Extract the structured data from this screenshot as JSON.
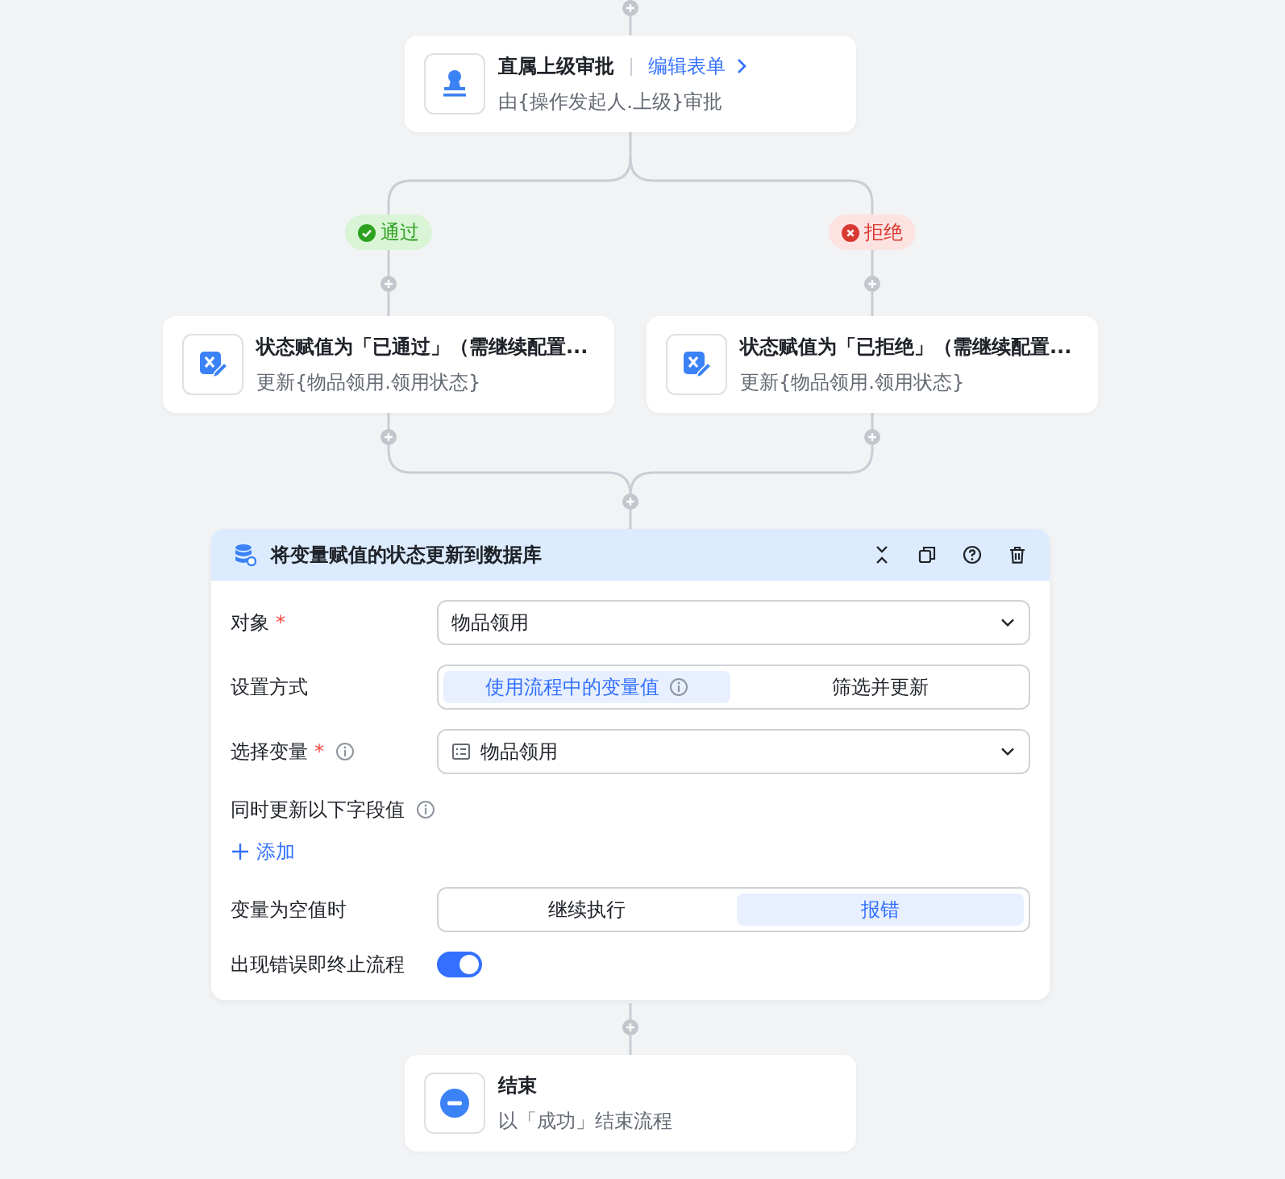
{
  "approval_node": {
    "title": "直属上级审批",
    "link": "编辑表单",
    "subtitle": "由{操作发起人.上级}审批"
  },
  "branches": [
    {
      "kind": "approve",
      "label": "通过",
      "node": {
        "title": "状态赋值为「已通过」（需继续配置...",
        "subtitle": "更新{物品领用.领用状态}"
      }
    },
    {
      "kind": "reject",
      "label": "拒绝",
      "node": {
        "title": "状态赋值为「已拒绝」（需继续配置...",
        "subtitle": "更新{物品领用.领用状态}"
      }
    }
  ],
  "update_node": {
    "title": "将变量赋值的状态更新到数据库",
    "fields": [
      {
        "kind": "select",
        "label": "对象",
        "required_mark": "*",
        "value": "物品领用"
      },
      {
        "kind": "segmented",
        "label": "设置方式",
        "options": [
          {
            "label": "使用流程中的变量值",
            "selected": true,
            "info": true
          },
          {
            "label": "筛选并更新",
            "selected": false
          }
        ]
      },
      {
        "kind": "select",
        "label": "选择变量",
        "required_mark": "*",
        "info": true,
        "value": "物品领用",
        "value_icon": true
      },
      {
        "kind": "list",
        "label": "同时更新以下字段值",
        "info": true,
        "action": "添加"
      },
      {
        "kind": "segmented",
        "label": "变量为空值时",
        "options": [
          {
            "label": "继续执行",
            "selected": false
          },
          {
            "label": "报错",
            "selected": true
          }
        ]
      },
      {
        "kind": "toggle",
        "label": "出现错误即终止流程",
        "on": true
      }
    ]
  },
  "end_node": {
    "title": "结束",
    "subtitle": "以「成功」结束流程"
  }
}
